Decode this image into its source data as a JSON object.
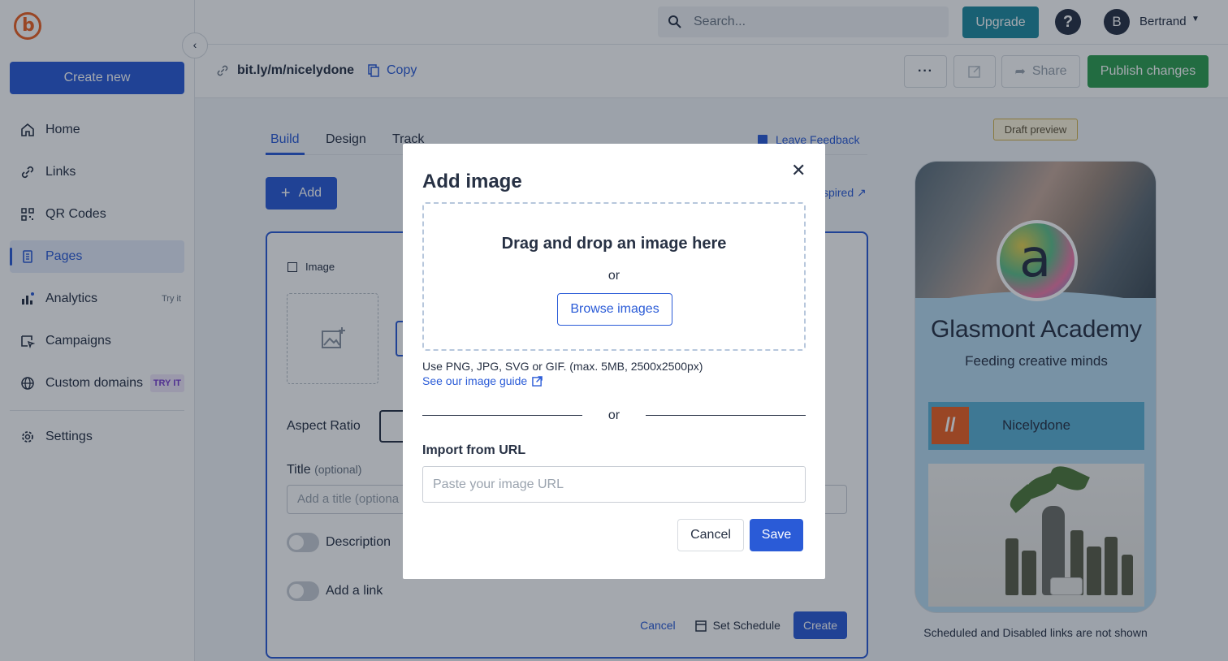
{
  "sidebar": {
    "create_new": "Create new",
    "collapse_icon": "chevron-left-icon",
    "items": [
      {
        "label": "Home",
        "icon": "home-icon"
      },
      {
        "label": "Links",
        "icon": "link-icon"
      },
      {
        "label": "QR Codes",
        "icon": "qr-code-icon"
      },
      {
        "label": "Pages",
        "icon": "page-icon",
        "active": true
      },
      {
        "label": "Analytics",
        "icon": "bar-chart-icon",
        "badge": "Try it"
      },
      {
        "label": "Campaigns",
        "icon": "campaign-icon"
      },
      {
        "label": "Custom domains",
        "icon": "globe-icon",
        "badge": "TRY IT"
      }
    ],
    "settings": {
      "label": "Settings",
      "icon": "gear-icon"
    }
  },
  "topbar": {
    "search_placeholder": "Search...",
    "upgrade": "Upgrade",
    "help": "?",
    "avatar_initial": "B",
    "username": "Bertrand"
  },
  "linkbar": {
    "short_link": "bit.ly/m/nicelydone",
    "copy": "Copy",
    "more": "···",
    "share": "Share",
    "publish": "Publish changes"
  },
  "editor": {
    "tabs": [
      "Build",
      "Design",
      "Track"
    ],
    "active_tab": "Build",
    "leave_feedback": "Leave Feedback",
    "add": "Add",
    "inspired_fragment": "spired",
    "card": {
      "title": "Image",
      "aspect_ratio": "Aspect Ratio",
      "title_label": "Title",
      "title_optional": "(optional)",
      "title_placeholder": "Add a title (optiona",
      "description": "Description",
      "add_link": "Add a link",
      "cancel": "Cancel",
      "set_schedule": "Set Schedule",
      "create": "Create"
    }
  },
  "preview": {
    "draft_label": "Draft preview",
    "name": "Glasmont Academy",
    "tagline": "Feeding creative minds",
    "link_label": "Nicelydone",
    "note": "Scheduled and Disabled links are not shown"
  },
  "modal": {
    "title": "Add image",
    "close_icon": "close-icon",
    "drop_title": "Drag and drop an image here",
    "or": "or",
    "browse": "Browse images",
    "formats_note": "Use PNG, JPG, SVG or GIF. (max. 5MB, 2500x2500px)",
    "guide_link": "See our image guide",
    "import_label": "Import from URL",
    "url_placeholder": "Paste your image URL",
    "url_value": "",
    "cancel": "Cancel",
    "save": "Save"
  },
  "colors": {
    "accent": "#2a5bd7",
    "upgrade": "#1f8ba0",
    "publish": "#2e9e4f",
    "logo": "#ee6123"
  }
}
